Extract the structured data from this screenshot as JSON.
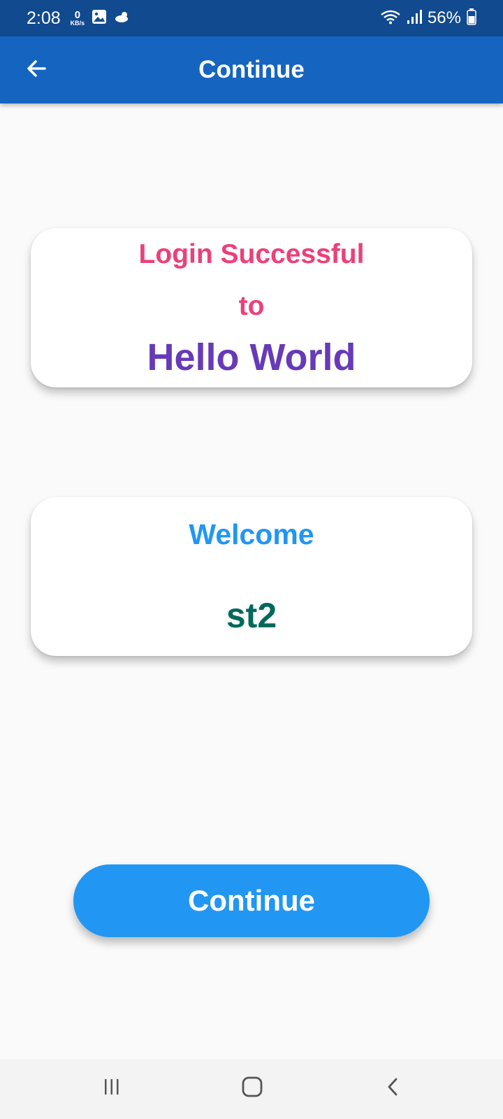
{
  "status_bar": {
    "time": "2:08",
    "net_speed_value": "0",
    "net_speed_unit": "KB/s",
    "battery": "56%"
  },
  "app_bar": {
    "title": "Continue",
    "back_icon": "arrow-left-icon"
  },
  "login_card": {
    "line1": "Login Successful",
    "line2": "to",
    "app_name": "Hello World"
  },
  "welcome_card": {
    "label": "Welcome",
    "username": "st2"
  },
  "continue_button": {
    "label": "Continue"
  },
  "nav_bar": {
    "recents_icon": "recents-icon",
    "home_icon": "home-icon",
    "back_icon": "nav-back-icon"
  },
  "colors": {
    "status_bar": "#114a8f",
    "app_bar": "#1565c0",
    "login_text": "#ec407a",
    "app_name": "#673ab7",
    "welcome_label": "#2196f3",
    "username": "#00695c",
    "button": "#2196f3"
  }
}
